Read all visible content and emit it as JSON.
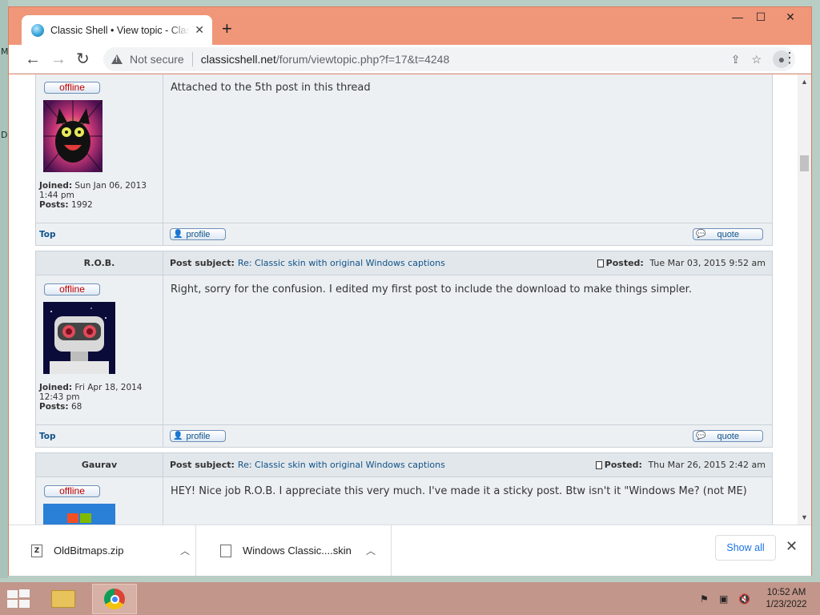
{
  "browser": {
    "tab_title": "Classic Shell • View topic - Classic Shell",
    "tab_close": "✕",
    "new_tab": "+",
    "security_label": "Not secure",
    "url_host": "classicshell.net",
    "url_path": "/forum/viewtopic.php?f=17&t=4248",
    "window_controls": {
      "minimize": "—",
      "maximize": "☐",
      "close": "✕"
    }
  },
  "desktop": {
    "fragments": [
      "M",
      "D"
    ]
  },
  "posts": [
    {
      "author": "",
      "subject_label": "",
      "subject": "",
      "posted_label": "",
      "posted": "",
      "status": "offline",
      "joined_label": "Joined:",
      "joined": "Sun Jan 06, 2013 1:44 pm",
      "posts_label": "Posts:",
      "posts": "1992",
      "message": "Attached to the 5th post in this thread",
      "top_label": "Top",
      "profile_label": "profile",
      "quote_label": "quote"
    },
    {
      "author": "R.O.B.",
      "subject_label": "Post subject:",
      "subject": "Re: Classic skin with original Windows captions",
      "posted_label": "Posted:",
      "posted": "Tue Mar 03, 2015 9:52 am",
      "status": "offline",
      "joined_label": "Joined:",
      "joined": "Fri Apr 18, 2014 12:43 pm",
      "posts_label": "Posts:",
      "posts": "68",
      "message": "Right, sorry for the confusion. I edited my first post to include the download to make things simpler.",
      "top_label": "Top",
      "profile_label": "profile",
      "quote_label": "quote"
    },
    {
      "author": "Gaurav",
      "subject_label": "Post subject:",
      "subject": "Re: Classic skin with original Windows captions",
      "posted_label": "Posted:",
      "posted": "Thu Mar 26, 2015 2:42 am",
      "status": "offline",
      "message": "HEY! Nice job R.O.B. I appreciate this very much. I've made it a sticky post. Btw isn't it \"Windows Me? (not ME)"
    }
  ],
  "downloads": {
    "items": [
      {
        "name": "OldBitmaps.zip",
        "icon": "zip-file-icon"
      },
      {
        "name": "Windows Classic....skin",
        "icon": "file-icon"
      }
    ],
    "show_all": "Show all",
    "close": "✕"
  },
  "taskbar": {
    "time": "10:52 AM",
    "date": "1/23/2022"
  },
  "colors": {
    "window_frame": "#f0977a",
    "taskbar": "#c2968a",
    "link": "#105289",
    "status_offline": "#c00000"
  }
}
